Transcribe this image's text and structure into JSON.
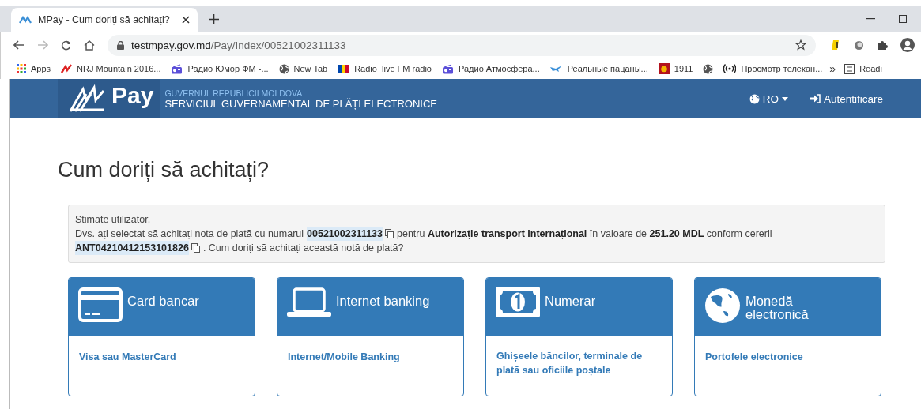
{
  "browser": {
    "tab_title": "MPay - Cum doriți să achitați?",
    "url_host": "testmpay.gov.md",
    "url_path": "/Pay/Index/00521002311133",
    "bookmarks": [
      {
        "kind": "apps",
        "label": "Apps"
      },
      {
        "kind": "logo",
        "label": "NRJ Mountain 2016..."
      },
      {
        "kind": "radio",
        "label": "Радио Юмор ФМ -..."
      },
      {
        "kind": "globe",
        "label": "New Tab"
      },
      {
        "kind": "flag",
        "label": "Radio  live FM radio"
      },
      {
        "kind": "radio",
        "label": "Радио Атмосфера..."
      },
      {
        "kind": "bird",
        "label": "Реальные пацаны..."
      },
      {
        "kind": "badge",
        "label": "1911"
      },
      {
        "kind": "globe"
      },
      {
        "kind": "broadcast",
        "label": "Просмотр телекан..."
      }
    ],
    "overflow": "»",
    "reading_list": "Readi"
  },
  "header": {
    "logo_text": "Pay",
    "org": "GUVERNUL REPUBLICII MOLDOVA",
    "service": "SERVICIUL GUVERNAMENTAL DE PLĂȚI ELECTRONICE",
    "language": "RO",
    "login": "Autentificare"
  },
  "heading": "Cum doriți să achitați?",
  "message": {
    "greeting": "Stimate utilizator,",
    "parts": [
      {
        "kind": "text",
        "text": "Dvs. ați selectat să achitați nota de plată cu numarul"
      },
      {
        "kind": "code",
        "text": "00521002311133"
      },
      {
        "kind": "copy"
      },
      {
        "kind": "text",
        "text": "pentru **Autorizație transport internațional** în valoare de **251.20 MDL** conform cererii"
      },
      {
        "kind": "code",
        "text": "ANT04210412153101826"
      },
      {
        "kind": "copy"
      },
      {
        "kind": "text",
        "text": ". Cum doriți să achitați această notă de plată?"
      }
    ]
  },
  "methods": [
    {
      "kind": "card",
      "title": "Card bancar",
      "option": "Visa sau MasterCard"
    },
    {
      "kind": "laptop",
      "title": "Internet banking",
      "option": "Internet/Mobile Banking"
    },
    {
      "kind": "cash",
      "title": "Numerar",
      "option": "Ghișeele băncilor, terminale de plată sau oficiile poștale"
    },
    {
      "kind": "globe",
      "title": "Monedă electronică",
      "option": "Portofele electronice"
    }
  ]
}
